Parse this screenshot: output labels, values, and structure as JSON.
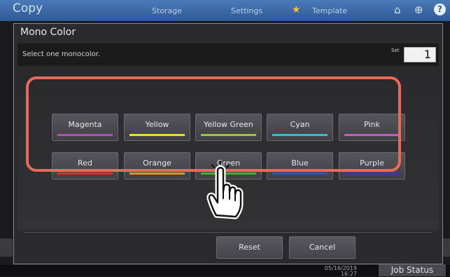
{
  "app": {
    "title": "Copy",
    "tabs": [
      "Storage",
      "Settings",
      "Template"
    ],
    "date": "05/16/2019",
    "time": "16:27",
    "job_status_label": "Job Status"
  },
  "dialog": {
    "title": "Mono Color",
    "instruction": "Select one monocolor.",
    "set_label": "Set",
    "set_value": "1",
    "colors": [
      {
        "label": "Magenta",
        "stripe": "#b14fb4"
      },
      {
        "label": "Yellow",
        "stripe": "#e8e32e"
      },
      {
        "label": "Yellow Green",
        "stripe": "#9cc43c"
      },
      {
        "label": "Cyan",
        "stripe": "#3ab9cf"
      },
      {
        "label": "Pink",
        "stripe": "#c45ec2"
      },
      {
        "label": "Red",
        "stripe": "#e2292a"
      },
      {
        "label": "Orange",
        "stripe": "#ee8a25"
      },
      {
        "label": "Green",
        "stripe": "#3fad3a"
      },
      {
        "label": "Blue",
        "stripe": "#2a56c2"
      },
      {
        "label": "Purple",
        "stripe": "#3b36a8"
      }
    ],
    "reset_label": "Reset",
    "cancel_label": "Cancel"
  },
  "highlight_color": "#e86a5a"
}
